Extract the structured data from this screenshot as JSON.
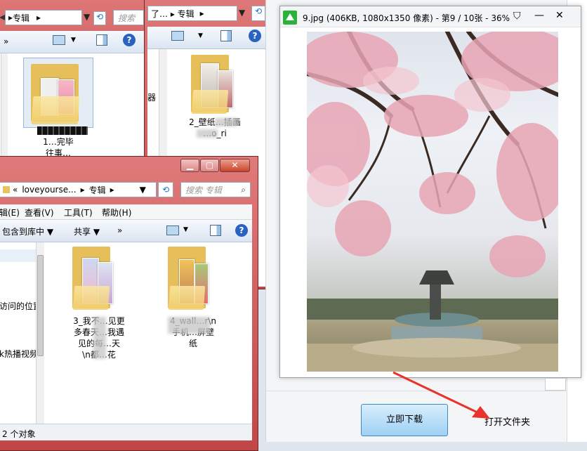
{
  "win1": {
    "addr_text": "专辑",
    "search_placeholder": "搜索",
    "toolbar_more": "»",
    "folder1_label_line1": "1",
    "folder1_label_line2": "1…完毕",
    "folder1_label_line3": "往事…"
  },
  "win2": {
    "addr_text": "了… ▸ 专辑",
    "search_placeholder": "",
    "folder_label_line1": "2_壁纸…插画",
    "folder_label_line2": "…o_ri",
    "nav_partial": "器"
  },
  "win3": {
    "addr_back": "«",
    "addr_crumb1": "loveyourse...",
    "addr_sep": "▸",
    "addr_crumb2": "专辑",
    "search_placeholder": "搜索 专辑",
    "menu": [
      "辑(E)",
      "查看(V)",
      "工具(T)",
      "帮助(H)"
    ],
    "toolbar": {
      "include": "包含到库中 ▼",
      "share": "共享 ▼",
      "more": "»"
    },
    "nav_items": [
      "访问的位置",
      "k热播视频"
    ],
    "folder3_lines": [
      "3_我不…见更",
      "多春天…我遇",
      "见的每…天",
      "\\n都…花"
    ],
    "folder4_lines": [
      "4_wall…r\\n",
      "手机…屏壁",
      "纸"
    ],
    "status": "2 个对象"
  },
  "viewer": {
    "title": "9.jpg (406KB, 1080x1350 像素) - 第9 / 10张 - 36%",
    "shirt_icon": "tshirt-icon",
    "min_icon": "minimize-icon",
    "close_icon": "close-icon"
  },
  "bottom": {
    "download_button": "立即下载",
    "open_folder": "打开文件夹"
  },
  "colors": {
    "accent_green": "#2bb23a",
    "arrow_red": "#e8322a",
    "window_frame": "#c9565c"
  }
}
